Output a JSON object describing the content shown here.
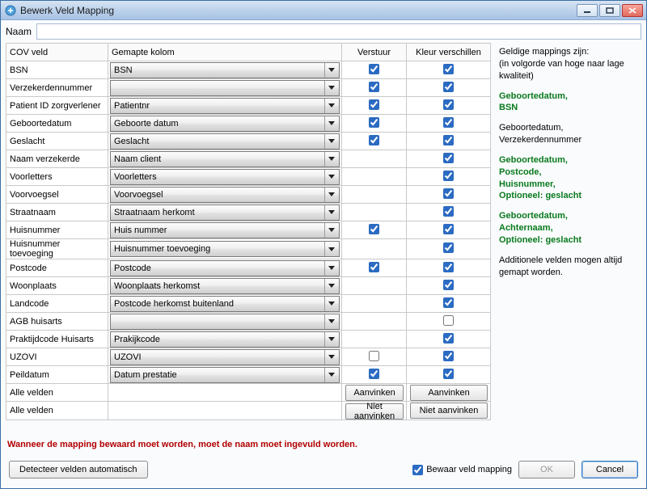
{
  "window": {
    "title": "Bewerk Veld Mapping"
  },
  "name": {
    "label": "Naam",
    "value": ""
  },
  "table": {
    "headers": {
      "c1": "COV veld",
      "c2": "Gemapte kolom",
      "c3": "Verstuur",
      "c4": "Kleur verschillen"
    },
    "rows": [
      {
        "field": "BSN",
        "mapped": "BSN",
        "send": true,
        "color": true
      },
      {
        "field": "Verzekerdennummer",
        "mapped": "",
        "send": true,
        "color": true
      },
      {
        "field": "Patient ID zorgverlener",
        "mapped": "Patientnr",
        "send": true,
        "color": true
      },
      {
        "field": "Geboortedatum",
        "mapped": "Geboorte datum",
        "send": true,
        "color": true
      },
      {
        "field": "Geslacht",
        "mapped": "Geslacht",
        "send": true,
        "color": true
      },
      {
        "field": "Naam verzekerde",
        "mapped": "Naam client",
        "send": null,
        "color": true
      },
      {
        "field": "Voorletters",
        "mapped": "Voorletters",
        "send": null,
        "color": true
      },
      {
        "field": "Voorvoegsel",
        "mapped": "Voorvoegsel",
        "send": null,
        "color": true
      },
      {
        "field": "Straatnaam",
        "mapped": "Straatnaam herkomt",
        "send": null,
        "color": true
      },
      {
        "field": "Huisnummer",
        "mapped": "Huis nummer",
        "send": true,
        "color": true
      },
      {
        "field": "Huisnummer toevoeging",
        "mapped": "Huisnummer toevoeging",
        "send": null,
        "color": true
      },
      {
        "field": "Postcode",
        "mapped": "Postcode",
        "send": true,
        "color": true
      },
      {
        "field": "Woonplaats",
        "mapped": "Woonplaats herkomst",
        "send": null,
        "color": true
      },
      {
        "field": "Landcode",
        "mapped": "Postcode herkomst buitenland",
        "send": null,
        "color": true
      },
      {
        "field": "AGB huisarts",
        "mapped": "",
        "send": null,
        "color": false
      },
      {
        "field": "Praktijdcode Huisarts",
        "mapped": "Prakijkcode",
        "send": null,
        "color": true
      },
      {
        "field": "UZOVI",
        "mapped": "UZOVI",
        "send": false,
        "color": true
      },
      {
        "field": "Peildatum",
        "mapped": "Datum prestatie",
        "send": true,
        "color": true
      }
    ],
    "footer": {
      "label": "Alle velden",
      "check": "Aanvinken",
      "uncheck": "Niet aanvinken"
    }
  },
  "side": {
    "intro1": "Geldige mappings zijn:",
    "intro2": "(in volgorde van hoge naar lage kwaliteit)",
    "g1a": "Geboortedatum,",
    "g1b": "BSN",
    "p2a": "Geboortedatum,",
    "p2b": "Verzekerdennummer",
    "g3a": "Geboortedatum,",
    "g3b": "Postcode,",
    "g3c": "Huisnummer,",
    "g3d": "Optioneel: geslacht",
    "g4a": "Geboortedatum,",
    "g4b": "Achternaam,",
    "g4c": "Optioneel: geslacht",
    "extra": "Additionele velden mogen altijd gemapt worden."
  },
  "warning": "Wanneer de mapping bewaard moet worden, moet de naam moet ingevuld worden.",
  "footer": {
    "detect": "Detecteer velden automatisch",
    "save_label": "Bewaar veld mapping",
    "save_checked": true,
    "ok": "OK",
    "cancel": "Cancel"
  }
}
